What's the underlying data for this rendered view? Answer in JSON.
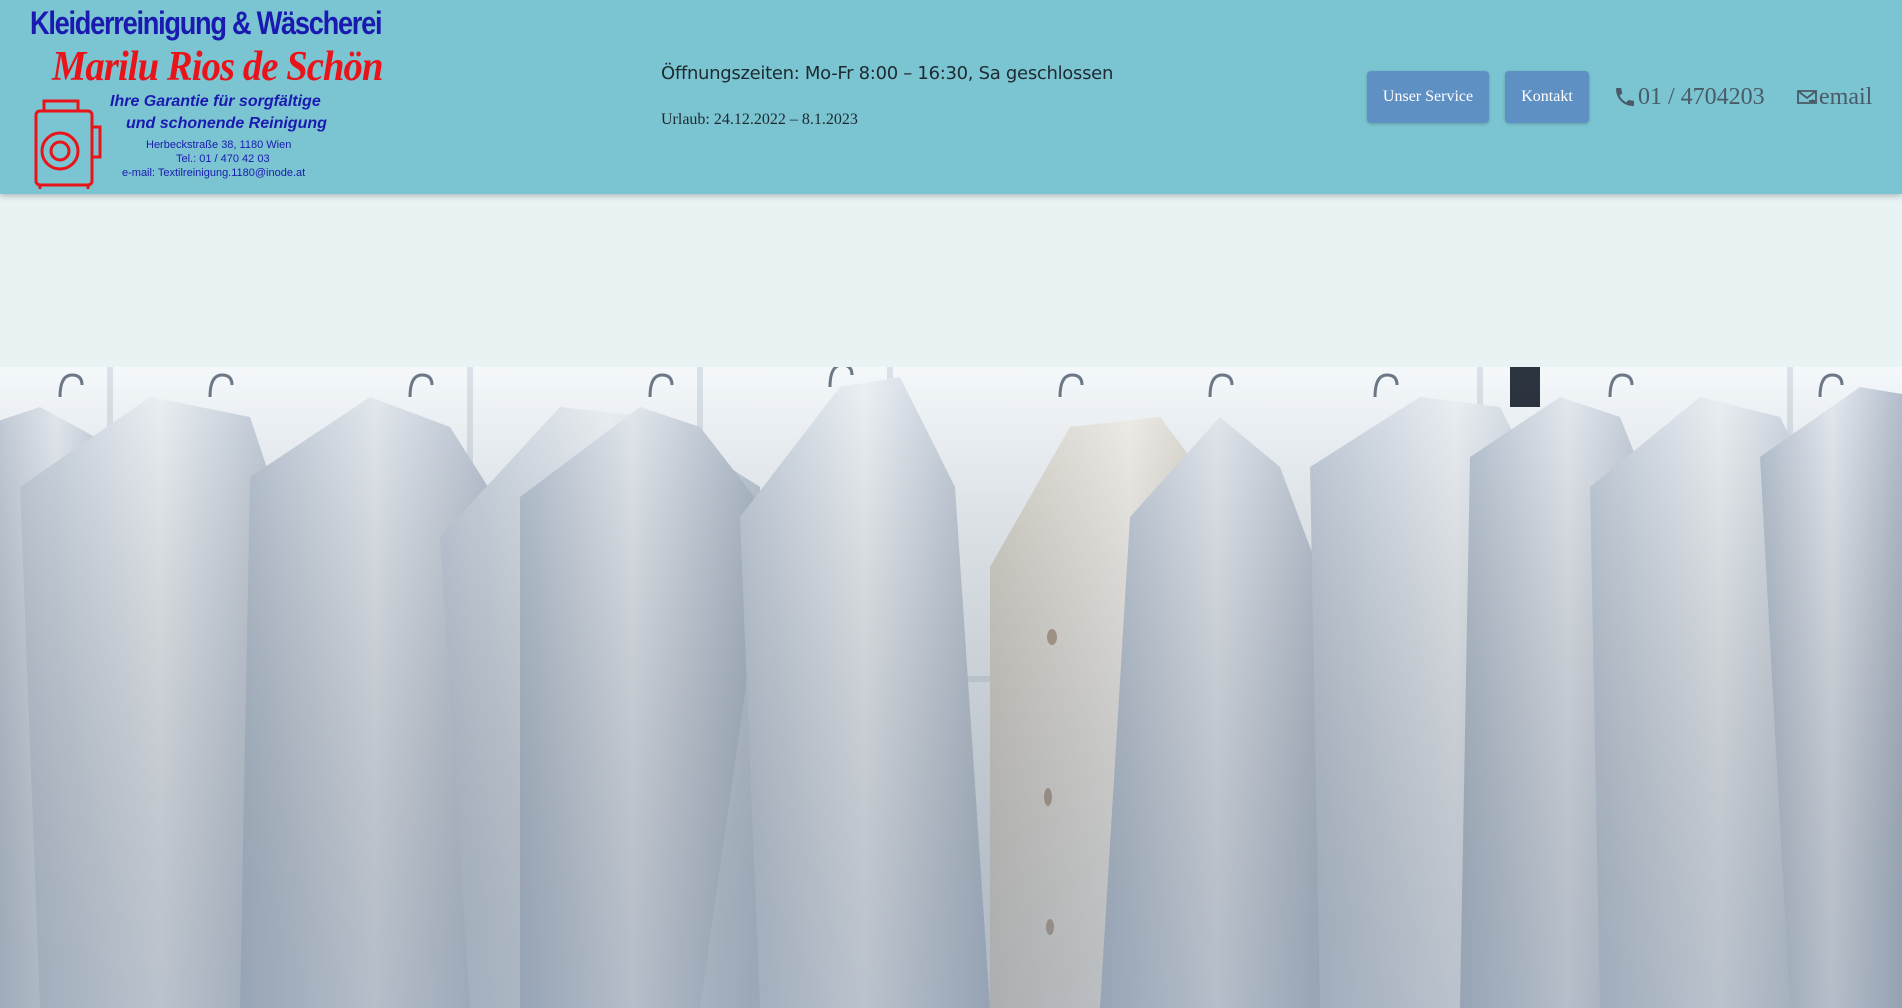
{
  "header": {
    "logo": {
      "line1": "Kleiderreinigung & Wäscherei",
      "line2": "Marilu Rios de Schön",
      "line3": "Ihre Garantie für sorgfältige",
      "line4": "und schonende Reinigung",
      "address": "Herbeckstraße 38, 1180 Wien",
      "tel": "Tel.: 01 / 470 42 03",
      "email": "e-mail: Textilreinigung.1180@inode.at",
      "icon": "dry-cleaning-machine-icon"
    },
    "hours": "Öffnungszeiten: Mo-Fr 8:00 – 16:30, Sa geschlossen",
    "vacation": "Urlaub: 24.12.2022 – 8.1.2023",
    "nav": {
      "service_label": "Unser Service",
      "contact_label": "Kontakt"
    },
    "phone": {
      "icon": "phone-icon",
      "label": "01 / 4704203"
    },
    "email": {
      "icon": "mail-icon",
      "label": "email"
    }
  },
  "hero": {
    "image": "white-shirts-on-hangers-photo"
  },
  "colors": {
    "header_bg": "#7bc4d1",
    "button_bg": "#5f90c4",
    "band_bg": "#e8f4f4",
    "logo_blue": "#1a1ab0",
    "logo_red": "#e8141a"
  }
}
